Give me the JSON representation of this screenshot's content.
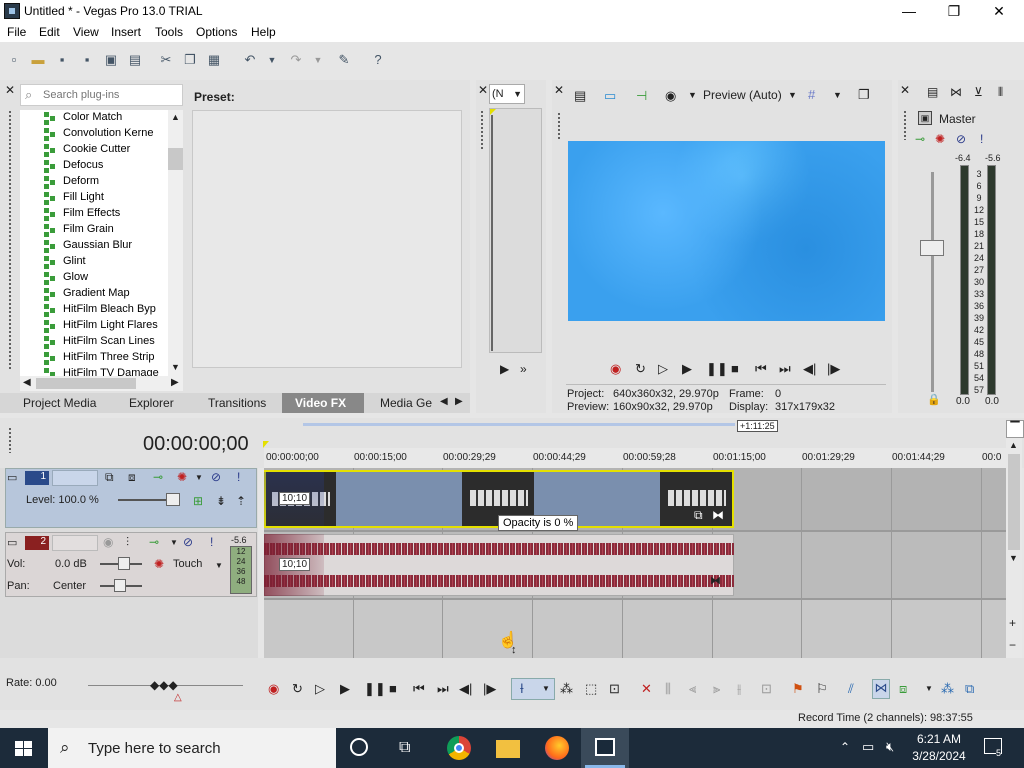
{
  "window": {
    "title": "Untitled * - Vegas Pro 13.0 TRIAL",
    "minimize": "—",
    "maximize": "❐",
    "close": "✕"
  },
  "menu": [
    "File",
    "Edit",
    "View",
    "Insert",
    "Tools",
    "Options",
    "Help"
  ],
  "fx_panel": {
    "search_placeholder": "Search plug-ins",
    "preset_label": "Preset:",
    "plugins": [
      "Color Match",
      "Convolution Kerne",
      "Cookie Cutter",
      "Defocus",
      "Deform",
      "Fill Light",
      "Film Effects",
      "Film Grain",
      "Gaussian Blur",
      "Glint",
      "Glow",
      "Gradient Map",
      "HitFilm Bleach Byp",
      "HitFilm Light Flares",
      "HitFilm Scan Lines",
      "HitFilm Three Strip",
      "HitFilm TV Damage"
    ],
    "tabs": [
      "Project Media",
      "Explorer",
      "Transitions",
      "Video FX",
      "Media Gen"
    ]
  },
  "trimmer": {
    "dropdown": "(N"
  },
  "preview": {
    "mode": "Preview (Auto)",
    "project_label": "Project:",
    "project_value": "640x360x32, 29.970p",
    "frame_label": "Frame:",
    "frame_value": "0",
    "preview_label": "Preview:",
    "preview_value": "160x90x32, 29.970p",
    "display_label": "Display:",
    "display_value": "317x179x32"
  },
  "master": {
    "title": "Master",
    "peak_left": "-6.4",
    "peak_right": "-5.6",
    "scale": [
      "3",
      "6",
      "9",
      "12",
      "15",
      "18",
      "21",
      "24",
      "27",
      "30",
      "33",
      "36",
      "39",
      "42",
      "45",
      "48",
      "51",
      "54",
      "57"
    ],
    "level_left": "0.0",
    "level_right": "0.0"
  },
  "timeline": {
    "timecode": "00:00:00;00",
    "length_marker": "+1:11:25",
    "ruler": [
      "00:00:00;00",
      "00:00:15;00",
      "00:00:29;29",
      "00:00:44;29",
      "00:00:59;28",
      "00:01:15;00",
      "00:01:29;29",
      "00:01:44;29",
      "00:0"
    ],
    "video_track": {
      "number": "1",
      "level": "Level: 100.0 %",
      "event_label": "10;10"
    },
    "audio_track": {
      "number": "2",
      "vol_label": "Vol:",
      "vol_value": "0.0 dB",
      "pan_label": "Pan:",
      "pan_value": "Center",
      "touch": "Touch",
      "peak": "-5.6",
      "meter": [
        "12",
        "24",
        "36",
        "48"
      ],
      "event_label": "10;10"
    },
    "tooltip": "Opacity is 0 %",
    "rate": "Rate: 0.00"
  },
  "status": {
    "record_time": "Record Time (2 channels): 98:37:55"
  },
  "taskbar": {
    "search": "Type here to search",
    "time": "6:21 AM",
    "date": "3/28/2024",
    "notifications": "5"
  }
}
